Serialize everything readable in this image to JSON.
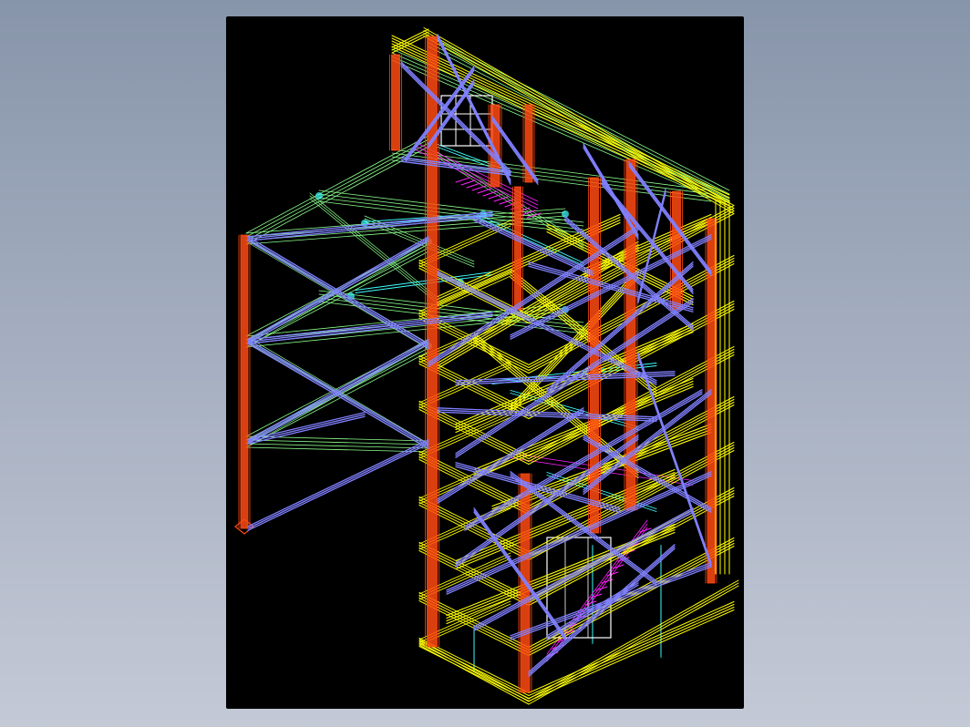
{
  "viewer": {
    "background_top": "#8795aa",
    "background_bottom": "#c4c9d6",
    "viewport_color": "#000000"
  },
  "model": {
    "type": "steel-structure-wireframe",
    "colors": {
      "columns": "#ff4a12",
      "braces": "#8080ff",
      "beams_green": "#8cff8c",
      "beams_yellow": "#ffff00",
      "stairs_magenta": "#ff20ff",
      "stringers_cyan": "#40ffff",
      "windows": "#ffffff"
    },
    "floors": 11,
    "left_frame_levels": 3,
    "stair_flights": 2
  }
}
